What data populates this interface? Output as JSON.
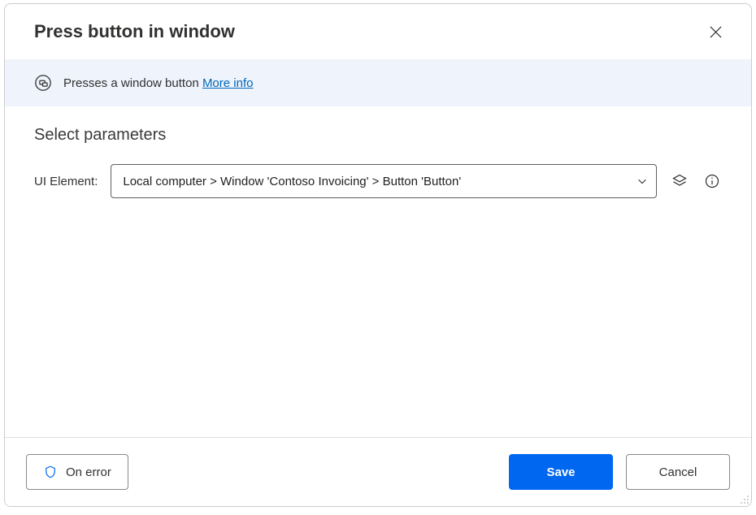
{
  "header": {
    "title": "Press button in window"
  },
  "info": {
    "text": "Presses a window button",
    "link_label": "More info"
  },
  "params": {
    "section_title": "Select parameters",
    "ui_element_label": "UI Element:",
    "ui_element_value": "Local computer > Window 'Contoso Invoicing' > Button 'Button'"
  },
  "footer": {
    "on_error_label": "On error",
    "save_label": "Save",
    "cancel_label": "Cancel"
  }
}
